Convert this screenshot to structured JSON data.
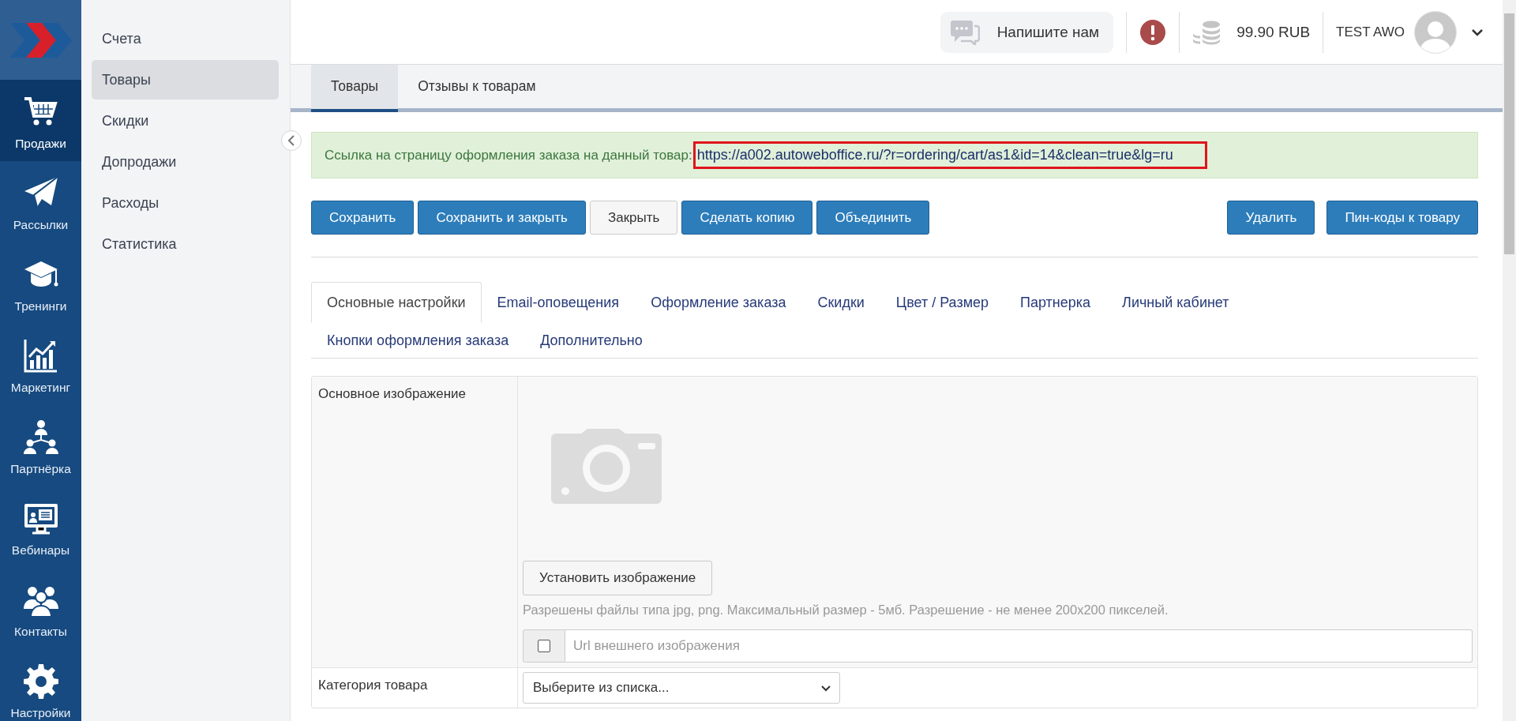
{
  "rail": {
    "items": [
      {
        "label": "Продажи",
        "selected": true
      },
      {
        "label": "Рассылки",
        "selected": false
      },
      {
        "label": "Тренинги",
        "selected": false
      },
      {
        "label": "Маркетинг",
        "selected": false
      },
      {
        "label": "Партнёрка",
        "selected": false
      },
      {
        "label": "Вебинары",
        "selected": false
      },
      {
        "label": "Контакты",
        "selected": false
      },
      {
        "label": "Настройки",
        "selected": false
      }
    ]
  },
  "submenu": {
    "items": [
      {
        "label": "Счета",
        "selected": false
      },
      {
        "label": "Товары",
        "selected": true
      },
      {
        "label": "Скидки",
        "selected": false
      },
      {
        "label": "Допродажи",
        "selected": false
      },
      {
        "label": "Расходы",
        "selected": false
      },
      {
        "label": "Статистика",
        "selected": false
      }
    ]
  },
  "header": {
    "chat_button": "Напишите нам",
    "balance": "99.90 RUB",
    "user_name": "TEST AWO"
  },
  "page_tabs": [
    {
      "label": "Товары",
      "selected": true
    },
    {
      "label": "Отзывы к товарам",
      "selected": false
    }
  ],
  "alert": {
    "text": "Ссылка на страницу оформления заказа на данный товар:",
    "link": "https://a002.autoweboffice.ru/?r=ordering/cart/as1&id=14&clean=true&lg=ru"
  },
  "actions_left": [
    {
      "label": "Сохранить",
      "kind": "primary"
    },
    {
      "label": "Сохранить и закрыть",
      "kind": "primary"
    },
    {
      "label": "Закрыть",
      "kind": "default"
    },
    {
      "label": "Сделать копию",
      "kind": "primary"
    },
    {
      "label": "Объединить",
      "kind": "primary"
    }
  ],
  "actions_right": [
    {
      "label": "Удалить",
      "kind": "primary"
    },
    {
      "label": "Пин-коды к товару",
      "kind": "primary"
    }
  ],
  "settings_tabs": [
    {
      "label": "Основные настройки",
      "selected": true
    },
    {
      "label": "Email-оповещения",
      "selected": false
    },
    {
      "label": "Оформление заказа",
      "selected": false
    },
    {
      "label": "Скидки",
      "selected": false
    },
    {
      "label": "Цвет / Размер",
      "selected": false
    },
    {
      "label": "Партнерка",
      "selected": false
    },
    {
      "label": "Личный кабинет",
      "selected": false
    },
    {
      "label": "Кнопки оформления заказа",
      "selected": false
    },
    {
      "label": "Дополнительно",
      "selected": false
    }
  ],
  "form": {
    "rows": [
      {
        "kind": "image",
        "label": "Основное изображение",
        "button": "Установить изображение",
        "hint": "Разрешены файлы типа jpg, png. Максимальный размер - 5мб. Разрешение - не менее 200x200 пикселей.",
        "url_checked": false,
        "url_placeholder": "Url внешнего изображения"
      },
      {
        "kind": "select",
        "label": "Категория товара",
        "value": "Выберите из списка..."
      }
    ]
  }
}
